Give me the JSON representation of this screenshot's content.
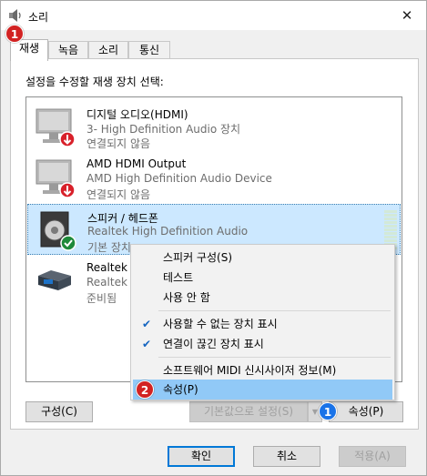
{
  "window": {
    "title": "소리",
    "close_glyph": "✕"
  },
  "badges": {
    "tab_badge": "1",
    "menu_badge": "2",
    "props_badge": "1"
  },
  "tabs": [
    {
      "label": "재생",
      "active": true
    },
    {
      "label": "녹음",
      "active": false
    },
    {
      "label": "소리",
      "active": false
    },
    {
      "label": "통신",
      "active": false
    }
  ],
  "instruction": "설정을 수정할 재생 장치 선택:",
  "devices": [
    {
      "name": "디지털 오디오(HDMI)",
      "description": "3- High Definition Audio 장치",
      "status": "연결되지 않음",
      "icon": "monitor-icon",
      "overlay": "disconnected-arrow-icon"
    },
    {
      "name": "AMD HDMI Output",
      "description": "AMD High Definition Audio Device",
      "status": "연결되지 않음",
      "icon": "monitor-icon",
      "overlay": "disconnected-arrow-icon"
    },
    {
      "name": "스피커 / 헤드폰",
      "description": "Realtek High Definition Audio",
      "status": "기본 장치",
      "icon": "speaker-icon",
      "overlay": "default-check-icon",
      "selected": true
    },
    {
      "name": "Realtek D",
      "description": "Realtek H",
      "status": "준비됨",
      "icon": "digital-output-icon"
    }
  ],
  "context_menu": {
    "items": [
      {
        "label": "스피커 구성(S)",
        "checked": false
      },
      {
        "label": "테스트",
        "checked": false
      },
      {
        "label": "사용 안 함",
        "checked": false
      },
      {
        "label": "사용할 수 없는 장치 표시",
        "checked": true
      },
      {
        "label": "연결이 끊긴 장치 표시",
        "checked": true
      },
      {
        "label": "소프트웨어 MIDI 신시사이저 정보(M)",
        "checked": false
      },
      {
        "label": "속성(P)",
        "checked": false,
        "highlighted": true
      }
    ],
    "check_glyph": "✔"
  },
  "panel_buttons": {
    "configure": "구성(C)",
    "set_default": "기본값으로 설정(S)",
    "split_arrow": "▼",
    "properties": "속성(P)"
  },
  "footer": {
    "ok": "확인",
    "cancel": "취소",
    "apply": "적용(A)"
  },
  "colors": {
    "selection": "#cce8ff",
    "menu_highlight": "#91c9f7",
    "accent": "#0078d7",
    "badge_red": "#d22222",
    "badge_blue": "#1a73e8"
  }
}
